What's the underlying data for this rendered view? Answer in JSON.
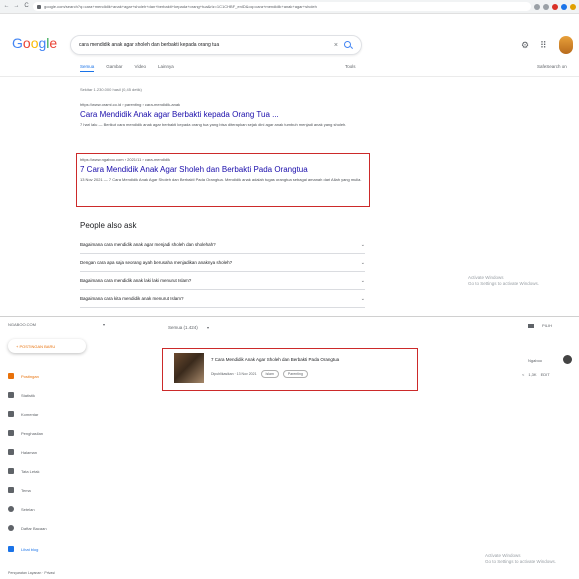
{
  "browser": {
    "nav_back": "←",
    "nav_forward": "→",
    "nav_reload": "C",
    "url": "google.com/search?q=cara+mendidik+anak+agar+sholeh+dan+berbakti+kepada+orang+tua&rlz=1C1CHBF_enID&oq=cara+mendidik+anak+agar+sholeh"
  },
  "google": {
    "logo_letters": [
      {
        "ch": "G",
        "color": "#4285f4"
      },
      {
        "ch": "o",
        "color": "#ea4335"
      },
      {
        "ch": "o",
        "color": "#fbbc05"
      },
      {
        "ch": "g",
        "color": "#4285f4"
      },
      {
        "ch": "l",
        "color": "#34a853"
      },
      {
        "ch": "e",
        "color": "#ea4335"
      }
    ],
    "query": "cara mendidik anak agar sholeh dan berbakti kepada orang tua",
    "clear": "×",
    "apps_icon": "⠿",
    "settings_icon": "⚙",
    "tabs": [
      "Semua",
      "Gambar",
      "Video",
      "Lainnya"
    ],
    "tools": "Tools",
    "safesearch": "SafeSearch on",
    "stats": "Sekitar 1.230.000 hasil (0,45 detik)",
    "results": [
      {
        "url": "https://www.orami.co.id › parenting › cara-mendidik-anak",
        "title": "Cara Mendidik Anak agar Berbakti kepada Orang Tua ...",
        "snippet": "7 hari lalu — Berikut cara mendidik anak agar berbakti kepada orang tua yang bisa diterapkan sejak dini agar anak tumbuh menjadi anak yang sholeh."
      },
      {
        "url": "https://www.ngaboo.com › 2021/11 › cara-mendidik",
        "title": "7 Cara Mendidik Anak Agar Sholeh dan Berbakti Pada Orangtua",
        "snippet": "13 Nov 2021 — 7 Cara Mendidik Anak Agar Sholeh dan Berbakti Pada Orangtua. Mendidik anak adalah tugas orangtua sebagai amanah dari Allah yang mulia."
      }
    ],
    "paa_title": "People also ask",
    "paa": [
      "Bagaimana cara mendidik anak agar menjadi sholeh dan sholehah?",
      "Dengan cara apa saja seorang ayah berusaha menjadikan anaknya sholeh?",
      "Bagaimana cara mendidik anak laki laki menurut Islam?",
      "Bagaimana cara kita mendidik anak menurut Islam?"
    ],
    "watermark": [
      "Activate Windows",
      "Go to Settings to activate Windows."
    ]
  },
  "blogger": {
    "blog_name": "NGABOO.COM",
    "blog_chevron": "▾",
    "new_post": "+ POSTINGAN BARU",
    "sidebar": [
      {
        "label": "Postingan",
        "icon": "posts-icon"
      },
      {
        "label": "Statistik",
        "icon": "stats-icon"
      },
      {
        "label": "Komentar",
        "icon": "comments-icon"
      },
      {
        "label": "Penghasilan",
        "icon": "earnings-icon"
      },
      {
        "label": "Halaman",
        "icon": "pages-icon"
      },
      {
        "label": "Tata Letak",
        "icon": "layout-icon"
      },
      {
        "label": "Tema",
        "icon": "theme-icon"
      },
      {
        "label": "Setelan",
        "icon": "settings-icon"
      },
      {
        "label": "Daftar Bacaan",
        "icon": "reading-list-icon"
      },
      {
        "label": "Lihat blog",
        "icon": "view-blog-icon"
      }
    ],
    "footer": "Persyaratan Layanan · Privasi",
    "filter": "Semua (1.424)",
    "filter_chevron": "▾",
    "top_right": "PILIH",
    "post": {
      "title": "7 Cara Mendidik Anak Agar Sholeh dan Berbakti Pada Orangtua",
      "meta": "Dipublikasikan · 13 Nov 2021",
      "labels": [
        "Islam",
        "Parenting"
      ],
      "author": "Ngaboo",
      "stats": "1,3K",
      "action": "EDIT"
    },
    "watermark": [
      "Activate Windows",
      "Go to Settings to activate Windows."
    ]
  }
}
